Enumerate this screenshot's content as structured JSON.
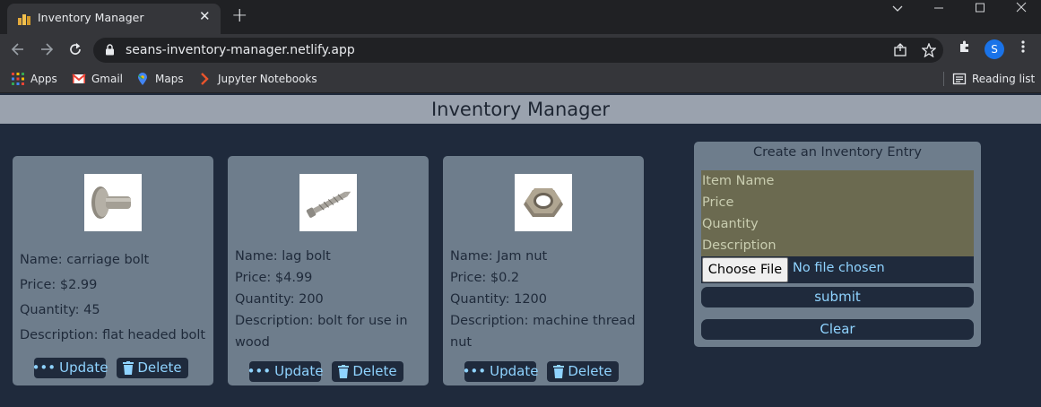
{
  "browser": {
    "tab_title": "Inventory Manager",
    "url": "seans-inventory-manager.netlify.app",
    "profile_initial": "S",
    "bookmarks": [
      {
        "label": "Apps"
      },
      {
        "label": "Gmail"
      },
      {
        "label": "Maps"
      },
      {
        "label": "Jupyter Notebooks"
      }
    ],
    "reading_list_label": "Reading list"
  },
  "page": {
    "title": "Inventory Manager"
  },
  "items": [
    {
      "name": "Name: carriage bolt",
      "price": "Price: $2.99",
      "quantity": "Quantity: 45",
      "description": "Description: flat headed bolt",
      "image_icon": "carriage-bolt"
    },
    {
      "name": "Name: lag bolt",
      "price": "Price: $4.99",
      "quantity": "Quantity: 200",
      "description": "Description: bolt for use in wood",
      "image_icon": "lag-bolt"
    },
    {
      "name": "Name: Jam nut",
      "price": "Price: $0.2",
      "quantity": "Quantity: 1200",
      "description": "Description: machine thread nut",
      "image_icon": "jam-nut"
    }
  ],
  "card_actions": {
    "update_label": "Update",
    "delete_label": "Delete"
  },
  "form": {
    "title": "Create an Inventory Entry",
    "item_name_placeholder": "Item Name",
    "price_placeholder": "Price",
    "quantity_placeholder": "Quantity",
    "description_placeholder": "Description",
    "choose_file_label": "Choose File",
    "no_file_label": "No file chosen",
    "submit_label": "submit",
    "clear_label": "Clear"
  },
  "colors": {
    "page_bg": "#1f2a3c",
    "header_bg": "#9aa2ae",
    "card_bg": "#6e7d8c",
    "button_text": "#8fd3ff",
    "input_block_bg": "#6b6a50"
  }
}
